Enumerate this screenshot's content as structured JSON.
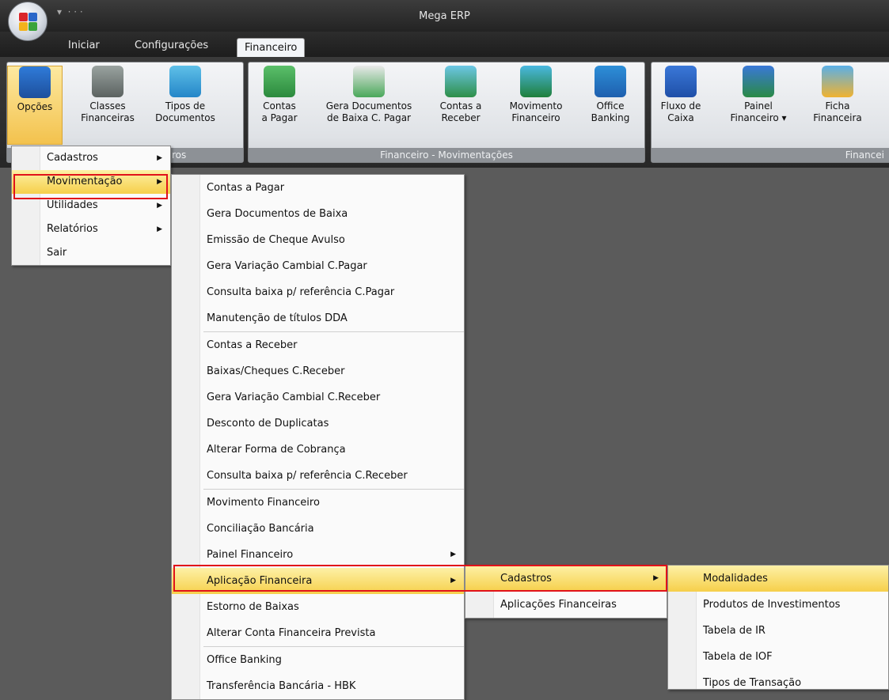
{
  "app": {
    "title": "Mega ERP"
  },
  "tabs": [
    {
      "label": "Iniciar"
    },
    {
      "label": "Configurações"
    },
    {
      "label": "Financeiro"
    }
  ],
  "ribbon": {
    "groups": [
      {
        "caption": "ros",
        "buttons": [
          {
            "label": "Opções",
            "icon": "options-icon"
          },
          {
            "label": "Classes\nFinanceiras",
            "icon": "file-cabinet-icon"
          },
          {
            "label": "Tipos de\nDocumentos",
            "icon": "documents-icon"
          }
        ]
      },
      {
        "caption": "Financeiro - Movimentações",
        "buttons": [
          {
            "label": "Contas\na Pagar",
            "icon": "pay-bills-icon"
          },
          {
            "label": "Gera Documentos\nde Baixa C. Pagar",
            "icon": "generate-docs-icon"
          },
          {
            "label": "Contas a\nReceber",
            "icon": "receive-bills-icon"
          },
          {
            "label": "Movimento\nFinanceiro",
            "icon": "money-chart-icon"
          },
          {
            "label": "Office\nBanking",
            "icon": "office-banking-icon"
          }
        ]
      },
      {
        "caption": "Financei",
        "buttons": [
          {
            "label": "Fluxo de\nCaixa",
            "icon": "cash-flow-icon"
          },
          {
            "label": "Painel\nFinanceiro ▾",
            "icon": "financial-panel-icon"
          },
          {
            "label": "Ficha\nFinanceira",
            "icon": "financial-sheet-icon"
          }
        ]
      }
    ]
  },
  "menu_main": [
    {
      "label": "Cadastros",
      "submenu": true
    },
    {
      "label": "Movimentação",
      "submenu": true,
      "highlighted": true
    },
    {
      "label": "Utilidades",
      "submenu": true
    },
    {
      "label": "Relatórios",
      "submenu": true
    },
    {
      "label": "Sair",
      "submenu": false
    }
  ],
  "menu_movimentacao": [
    {
      "label": "Contas a Pagar"
    },
    {
      "label": "Gera Documentos de Baixa"
    },
    {
      "label": "Emissão de Cheque Avulso"
    },
    {
      "label": "Gera Variação Cambial C.Pagar"
    },
    {
      "label": "Consulta baixa p/ referência C.Pagar"
    },
    {
      "label": "Manutenção de títulos DDA"
    },
    {
      "separator": true
    },
    {
      "label": "Contas a Receber"
    },
    {
      "label": "Baixas/Cheques C.Receber"
    },
    {
      "label": "Gera Variação Cambial C.Receber"
    },
    {
      "label": "Desconto de Duplicatas"
    },
    {
      "label": "Alterar Forma de Cobrança"
    },
    {
      "label": "Consulta baixa p/ referência C.Receber"
    },
    {
      "separator": true
    },
    {
      "label": "Movimento Financeiro"
    },
    {
      "label": "Conciliação Bancária"
    },
    {
      "label": "Painel Financeiro",
      "submenu": true
    },
    {
      "label": "Aplicação Financeira",
      "submenu": true,
      "highlighted": true
    },
    {
      "label": "Estorno de Baixas"
    },
    {
      "label": "Alterar Conta Financeira Prevista"
    },
    {
      "separator": true
    },
    {
      "label": "Office Banking"
    },
    {
      "label": "Transferência Bancária - HBK"
    }
  ],
  "menu_aplicacao": [
    {
      "label": "Cadastros",
      "submenu": true,
      "highlighted": true
    },
    {
      "label": "Aplicações Financeiras"
    }
  ],
  "menu_cadastros": [
    {
      "label": "Modalidades",
      "highlighted": true
    },
    {
      "label": "Produtos de Investimentos"
    },
    {
      "label": "Tabela de IR"
    },
    {
      "label": "Tabela de IOF"
    },
    {
      "label": "Tipos de Transação"
    }
  ],
  "colors": {
    "highlight": "#f6cf4a",
    "annotation_box": "#e1121a"
  }
}
